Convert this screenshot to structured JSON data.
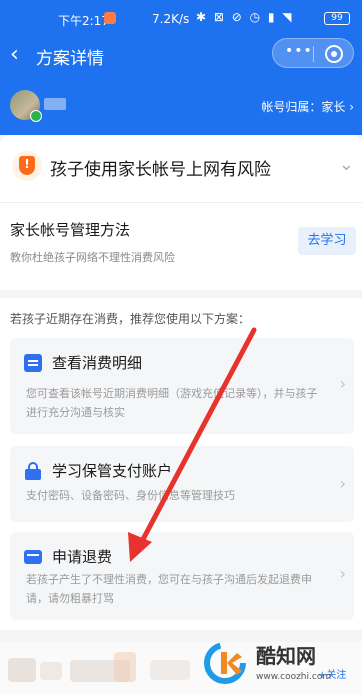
{
  "status_bar": {
    "time": "下午2:17",
    "network_speed": "7.2K/s",
    "icons_text": "✱ ⊠ ⊘ ◷ ▮ ◥",
    "battery": "99"
  },
  "nav": {
    "back_icon": "‹",
    "title": "方案详情",
    "more_icon": "•••"
  },
  "account": {
    "owner_label": "帐号归属：家长",
    "owner_arrow": "›"
  },
  "risk": {
    "title": "孩子使用家长帐号上网有风险",
    "chevron": "⌄"
  },
  "method": {
    "title": "家长帐号管理方法",
    "subtitle": "教你杜绝孩子网络不理性消费风险",
    "button": "去学习"
  },
  "intro": "若孩子近期存在消费，推荐您使用以下方案：",
  "options": [
    {
      "title": "查看消费明细",
      "desc": "您可查看该帐号近期消费明细（游戏充值记录等），并与孩子进行充分沟通与核实",
      "icon": "document-icon",
      "arrow": "›"
    },
    {
      "title": "学习保管支付账户",
      "desc": "支付密码、设备密码、身份信息等管理技巧",
      "icon": "lock-icon",
      "arrow": "›"
    },
    {
      "title": "申请退费",
      "desc": "若孩子产生了不理性消费，您可在与孩子沟通后发起退费申请，请勿粗暴打骂",
      "icon": "card-icon",
      "arrow": "›"
    }
  ],
  "bottom": {
    "follow": "+关注"
  },
  "watermark": {
    "name": "酷知网",
    "url": "www.coozhi.com"
  },
  "colors": {
    "brand_blue": "#1f72ef",
    "warning_orange": "#ff6a1a",
    "annotation_red": "#e8322d"
  }
}
